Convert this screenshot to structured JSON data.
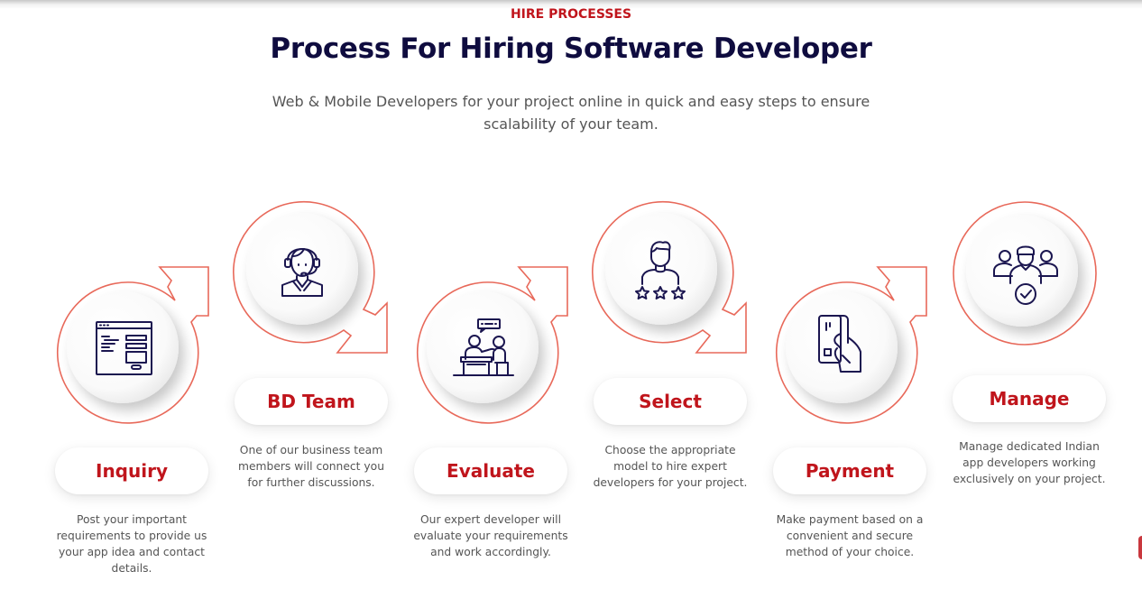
{
  "header": {
    "eyebrow": "HIRE PROCESSES",
    "title": "Process For Hiring Software Developer",
    "subtitle": "Web & Mobile Developers for your project online in quick and easy steps to ensure scalability of your team."
  },
  "colors": {
    "accent": "#c0151c",
    "ring": "#e8695a",
    "title": "#0f0c3f",
    "icon": "#1b1650",
    "body_text": "#555555"
  },
  "steps": [
    {
      "label": "Inquiry",
      "icon": "web-form-icon",
      "arrow": "up-right",
      "description": "Post your important requirements to provide us your app idea and contact details."
    },
    {
      "label": "BD Team",
      "icon": "headset-agent-icon",
      "arrow": "down-right",
      "description": "One of our business team members will connect you for further discussions."
    },
    {
      "label": "Evaluate",
      "icon": "interview-meeting-icon",
      "arrow": "up-right",
      "description": "Our expert developer will evaluate your requirements and work accordingly."
    },
    {
      "label": "Select",
      "icon": "person-rating-stars-icon",
      "arrow": "down-right",
      "description": "Choose the appropriate model to hire expert developers for your project."
    },
    {
      "label": "Payment",
      "icon": "hand-card-payment-icon",
      "arrow": "up-right",
      "description": "Make payment based on a convenient and secure method of your choice."
    },
    {
      "label": "Manage",
      "icon": "team-check-icon",
      "arrow": "none",
      "description": "Manage dedicated Indian app developers working exclusively on your project."
    }
  ]
}
